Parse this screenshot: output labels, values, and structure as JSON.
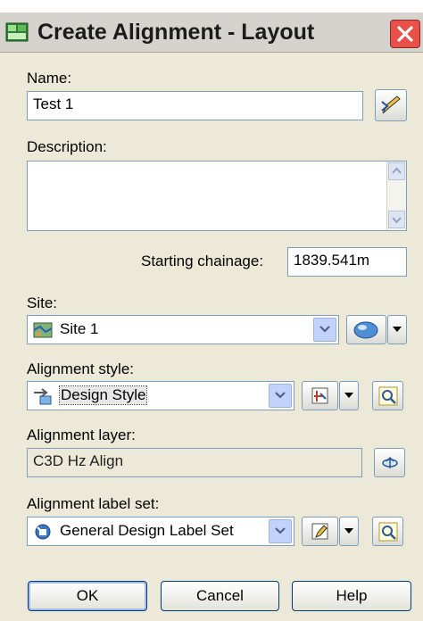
{
  "window": {
    "title": "Create Alignment - Layout"
  },
  "name": {
    "label": "Name:",
    "value": "Test 1"
  },
  "description": {
    "label": "Description:",
    "value": ""
  },
  "starting_chainage": {
    "label": "Starting chainage:",
    "value": "1839.541m"
  },
  "site": {
    "label": "Site:",
    "value": "Site 1"
  },
  "alignment_style": {
    "label": "Alignment style:",
    "value": "Design Style"
  },
  "alignment_layer": {
    "label": "Alignment layer:",
    "value": "C3D Hz Align"
  },
  "alignment_label_set": {
    "label": "Alignment label set:",
    "value": "General Design Label Set"
  },
  "buttons": {
    "ok": "OK",
    "cancel": "Cancel",
    "help": "Help"
  },
  "colors": {
    "close_button": "#e8504a",
    "dialog_bg": "#ece9d8",
    "field_border": "#7f9db9"
  }
}
